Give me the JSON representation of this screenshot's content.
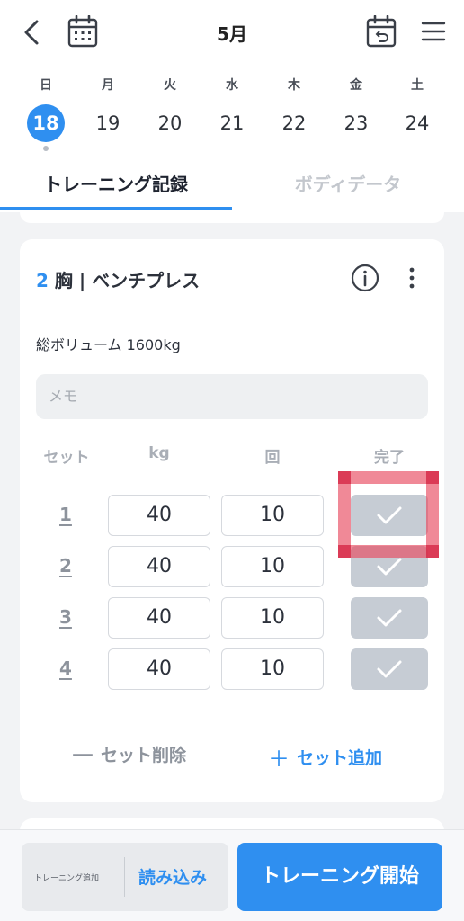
{
  "header": {
    "month": "5月",
    "week": [
      {
        "weekday": "日",
        "date": "18",
        "selected": true,
        "has_record": true
      },
      {
        "weekday": "月",
        "date": "19",
        "selected": false,
        "has_record": false
      },
      {
        "weekday": "火",
        "date": "20",
        "selected": false,
        "has_record": false
      },
      {
        "weekday": "水",
        "date": "21",
        "selected": false,
        "has_record": false
      },
      {
        "weekday": "木",
        "date": "22",
        "selected": false,
        "has_record": false
      },
      {
        "weekday": "金",
        "date": "23",
        "selected": false,
        "has_record": false
      },
      {
        "weekday": "土",
        "date": "24",
        "selected": false,
        "has_record": false
      }
    ],
    "tabs": [
      {
        "label": "トレーニング記録",
        "active": true
      },
      {
        "label": "ボディデータ",
        "active": false
      }
    ]
  },
  "exercise": {
    "number": "2",
    "name": "胸 | ベンチプレス",
    "volume": "総ボリューム 1600kg",
    "memo_placeholder": "メモ",
    "columns": {
      "set": "セット",
      "kg": "kg",
      "reps": "回",
      "done": "完了"
    },
    "sets": [
      {
        "num": "1",
        "kg": "40",
        "reps": "10",
        "done": false
      },
      {
        "num": "2",
        "kg": "40",
        "reps": "10",
        "done": false
      },
      {
        "num": "3",
        "kg": "40",
        "reps": "10",
        "done": false
      },
      {
        "num": "4",
        "kg": "40",
        "reps": "10",
        "done": false
      }
    ],
    "delete_set": "セット削除",
    "add_set": "セット追加"
  },
  "bottom": {
    "add_training_small": "トレーニング追加",
    "load": "読み込み",
    "start": "トレーニング開始"
  },
  "colors": {
    "accent": "#2f8ff0",
    "highlight": "#e84a60"
  },
  "icons": [
    "back-arrow-icon",
    "calendar-icon",
    "calendar-reset-icon",
    "hamburger-menu-icon",
    "info-icon",
    "more-vertical-icon",
    "check-icon",
    "minus-icon",
    "plus-icon"
  ]
}
